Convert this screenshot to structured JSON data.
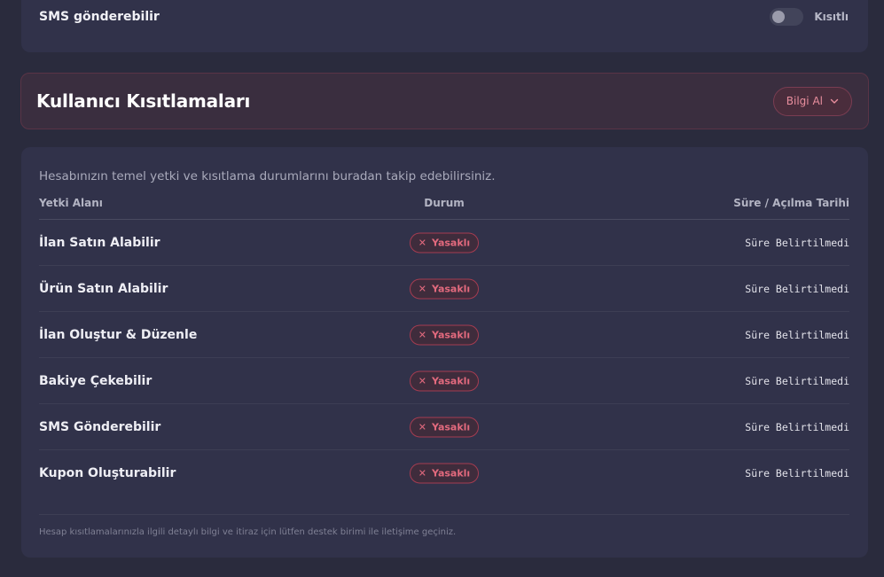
{
  "top": {
    "label": "SMS gönderebilir",
    "toggle_text": "Kısıtlı"
  },
  "banner": {
    "title": "Kullanıcı Kısıtlamaları",
    "info_button": "Bilgi Al"
  },
  "main": {
    "description": "Hesabınızın temel yetki ve kısıtlama durumlarını buradan takip edebilirsiniz.",
    "headers": {
      "area": "Yetki Alanı",
      "status": "Durum",
      "date": "Süre / Açılma Tarihi"
    },
    "rows": [
      {
        "name": "İlan Satın Alabilir",
        "status": "Yasaklı",
        "date": "Süre Belirtilmedi"
      },
      {
        "name": "Ürün Satın Alabilir",
        "status": "Yasaklı",
        "date": "Süre Belirtilmedi"
      },
      {
        "name": "İlan Oluştur & Düzenle",
        "status": "Yasaklı",
        "date": "Süre Belirtilmedi"
      },
      {
        "name": "Bakiye Çekebilir",
        "status": "Yasaklı",
        "date": "Süre Belirtilmedi"
      },
      {
        "name": "SMS Gönderebilir",
        "status": "Yasaklı",
        "date": "Süre Belirtilmedi"
      },
      {
        "name": "Kupon Oluşturabilir",
        "status": "Yasaklı",
        "date": "Süre Belirtilmedi"
      }
    ],
    "footer_note": "Hesap kısıtlamalarınızla ilgili detaylı bilgi ve itiraz için lütfen destek birimi ile iletişime geçiniz."
  },
  "icons": {
    "status_icon": "close-icon",
    "dropdown_icon": "chevron-down-icon"
  },
  "colors": {
    "background": "#2a2b3d",
    "card": "#31324a",
    "danger": "#e36a7e",
    "banner": "#3a2e3f"
  }
}
